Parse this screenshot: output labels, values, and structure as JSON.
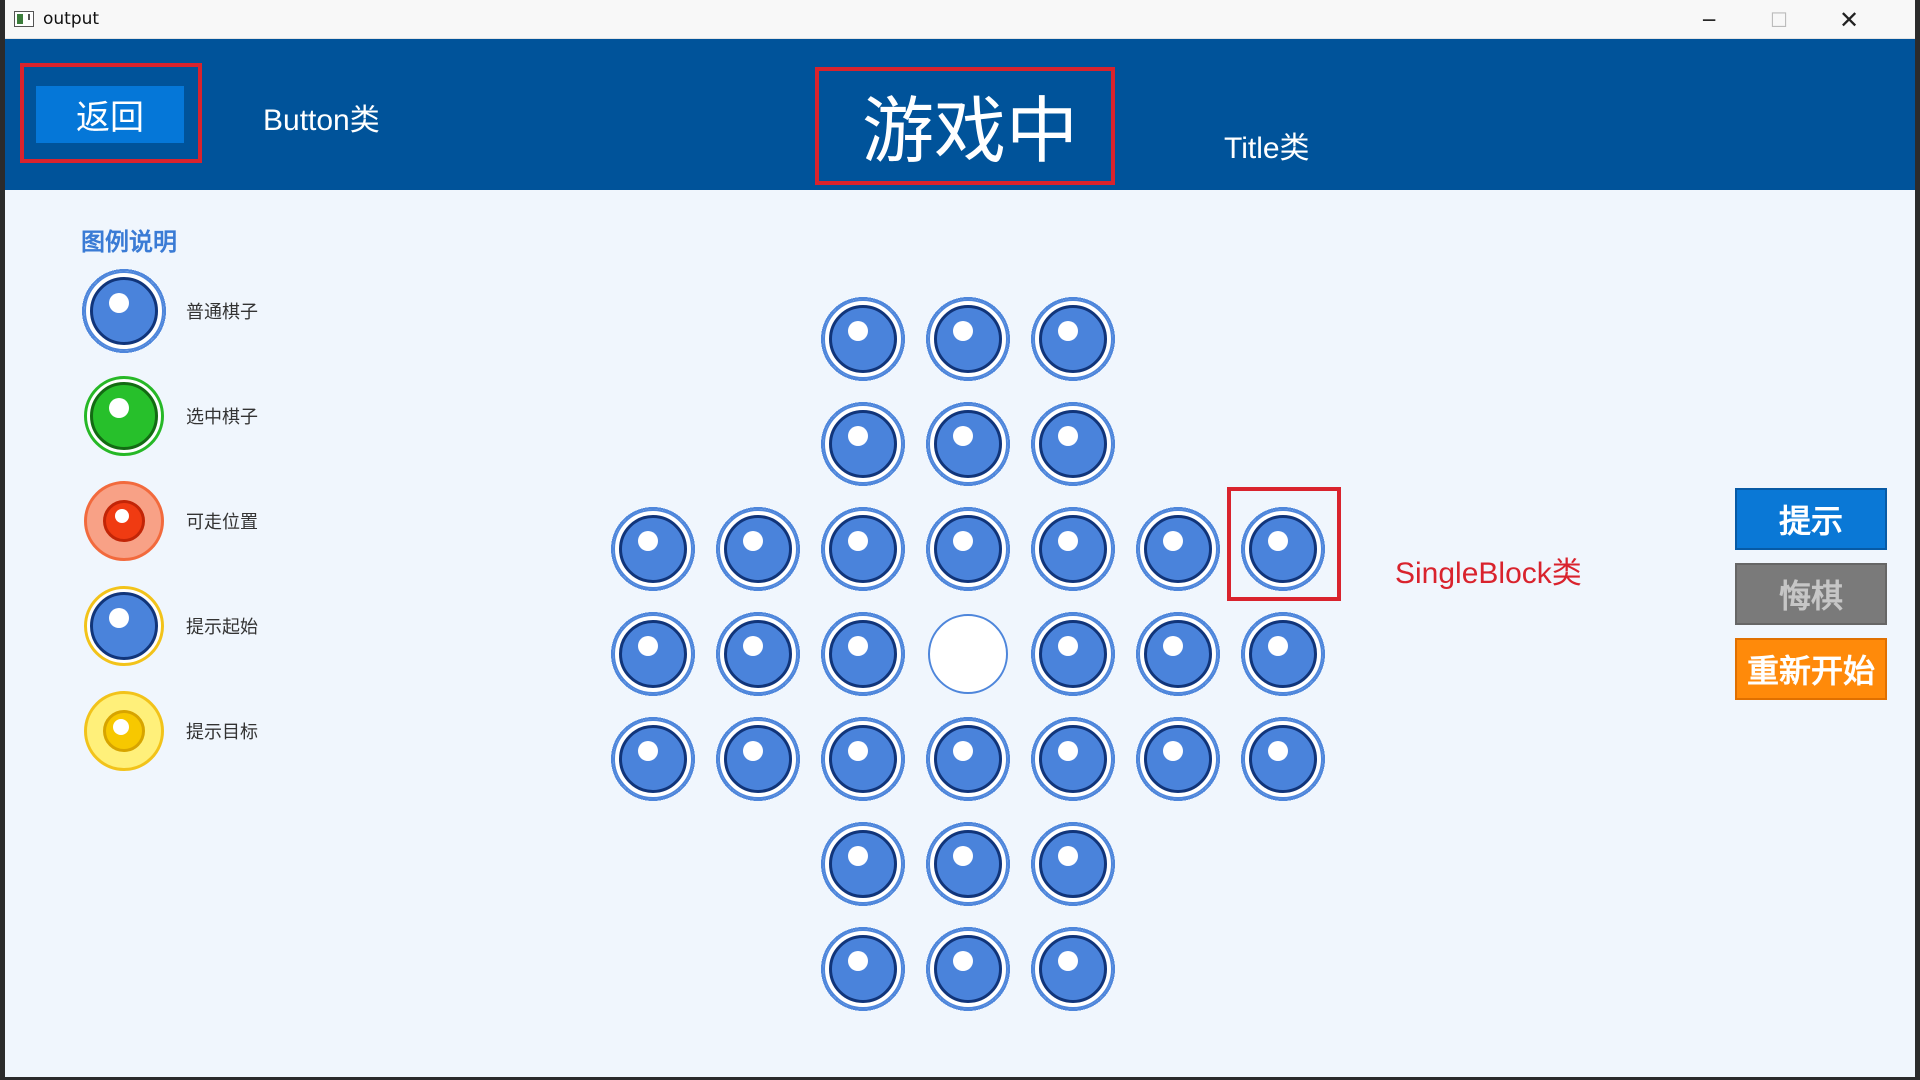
{
  "window": {
    "title": "output",
    "minimize": "─",
    "maximize": "☐",
    "close": "✕"
  },
  "header": {
    "back_label": "返回",
    "button_class_note": "Button类",
    "title": "游戏中",
    "title_class_note": "Title类"
  },
  "legend": {
    "title": "图例说明",
    "items": [
      {
        "label": "普通棋子",
        "type": "normal"
      },
      {
        "label": "选中棋子",
        "type": "selected"
      },
      {
        "label": "可走位置",
        "type": "movable"
      },
      {
        "label": "提示起始",
        "type": "hint-start"
      },
      {
        "label": "提示目标",
        "type": "hint-target"
      }
    ]
  },
  "board": {
    "rows": [
      "  OOO  ",
      "  OOO  ",
      "OOOOOOO",
      "OOO.OOO",
      "OOOOOOO",
      "  OOO  ",
      "  OOO  "
    ],
    "annotated_cell": {
      "row": 2,
      "col": 6
    }
  },
  "single_block_note": "SingleBlock类",
  "buttons": {
    "hint": "提示",
    "undo": "悔棋",
    "restart": "重新开始"
  },
  "colors": {
    "header_bg": "#00539a",
    "page_bg": "#f0f6fd",
    "annotation": "#d9232d",
    "peg_blue": "#4a83db"
  }
}
